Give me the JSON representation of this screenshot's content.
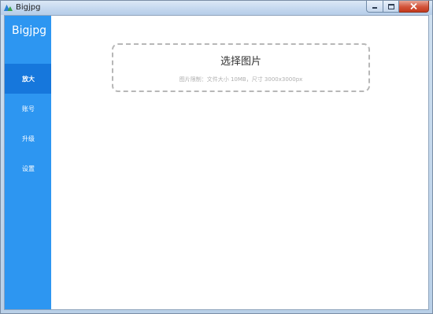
{
  "window": {
    "title": "Bigjpg",
    "icon": "bigjpg-logo-icon"
  },
  "sidebar": {
    "brand": "Bigjpg",
    "items": [
      {
        "label": "放大",
        "active": true
      },
      {
        "label": "账号",
        "active": false
      },
      {
        "label": "升级",
        "active": false
      },
      {
        "label": "设置",
        "active": false
      }
    ]
  },
  "upload": {
    "title": "选择图片",
    "hint": "图片限制：文件大小 10MB，尺寸 3000x3000px"
  },
  "colors": {
    "sidebar": "#2d96f1",
    "sidebar_active": "#1677dc",
    "dashed_border": "#b7b7b7"
  }
}
